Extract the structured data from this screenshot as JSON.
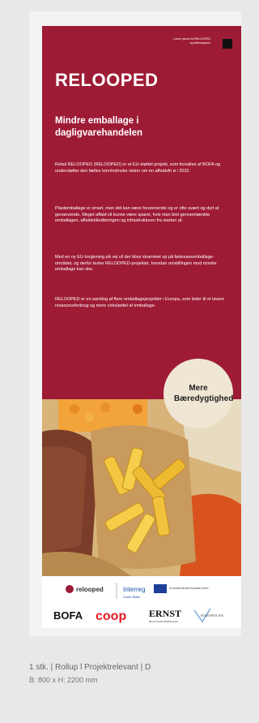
{
  "banner": {
    "top_tag": "Lorem ipsum fra RELOOPED og fællesstyrken",
    "title": "RELOOPED",
    "subtitle": "Mindre emballage i dagligvarehandelen",
    "paragraphs": [
      "Retail RELOOPED (RELOOPED) er et EU-støttet projekt, som forvaltes af BOFA og understøtter den fælles bornholmske vision om en affaldsfri ø i 2032.",
      "Plastemballage er smart, men det kan være forurenende og er ofte svært og dyrt at genanvende. Meget affald vil kunne være sparet, hvis man blot gennemtænkte emballagen, affaldshåndteringen og infrastrukturen fra starten af.",
      "Med en ny EU-lovgivning på vej vil der blive strammet op på fødevareemballage-området, og derfor tester RELOOPED-projektet, hvordan omstillingen mod mindre emballage kan ske.",
      "RELOOPED er en samling af flere emballageprojekter i Europa, som leder til et lavere ressourceforbrug og mere cirkularitet af emballage."
    ],
    "badge": "Mere Bæredygtighed",
    "logos": {
      "relooped": "relooped",
      "interreg": "Interreg",
      "interreg_sub": "South Baltic",
      "eu": "Co-funded by the European Union",
      "bofa": "BOFA",
      "coop": "coop",
      "ernst": "ERNST",
      "ernst_sub": "ØKOLOGISK BORNHOLM",
      "last": "BORNHOLMS"
    }
  },
  "caption": {
    "line1": "1 stk. | Rollup l Projektrelevant | D",
    "line2": "B: 800 x H: 2200 mm"
  }
}
